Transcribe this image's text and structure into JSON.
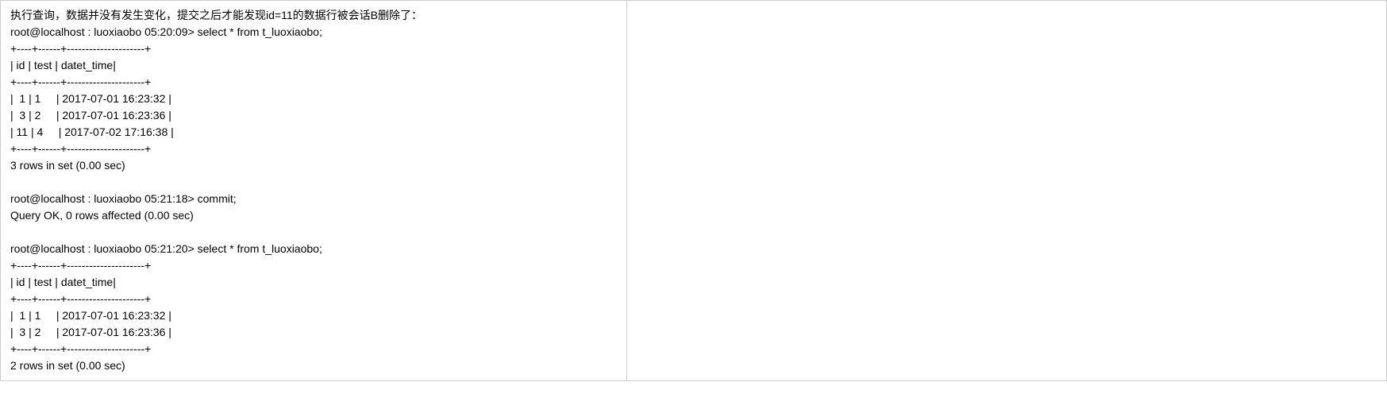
{
  "left": {
    "intro": "执行查询，数据并没有发生变化，提交之后才能发现id=11的数据行被会话B删除了：",
    "prompt1": "root@localhost : luoxiaobo 05:20:09> select * from t_luoxiaobo;",
    "sep1a": "+----+------+---------------------+",
    "header1": "| id | test | datet_time|",
    "sep1b": "+----+------+---------------------+",
    "row1_1": "|  1 | 1     | 2017-07-01 16:23:32 |",
    "row1_2": "|  3 | 2     | 2017-07-01 16:23:36 |",
    "row1_3": "| 11 | 4     | 2017-07-02 17:16:38 |",
    "sep1c": "+----+------+---------------------+",
    "result1": "3 rows in set (0.00 sec)",
    "blank1": "",
    "prompt2": "root@localhost : luoxiaobo 05:21:18> commit;",
    "result2": "Query OK, 0 rows affected (0.00 sec)",
    "blank2": "",
    "prompt3": "root@localhost : luoxiaobo 05:21:20> select * from t_luoxiaobo;",
    "sep3a": "+----+------+---------------------+",
    "header3": "| id | test | datet_time|",
    "sep3b": "+----+------+---------------------+",
    "row3_1": "|  1 | 1     | 2017-07-01 16:23:32 |",
    "row3_2": "|  3 | 2     | 2017-07-01 16:23:36 |",
    "sep3c": "+----+------+---------------------+",
    "result3": "2 rows in set (0.00 sec)"
  },
  "right": {
    "content": ""
  }
}
